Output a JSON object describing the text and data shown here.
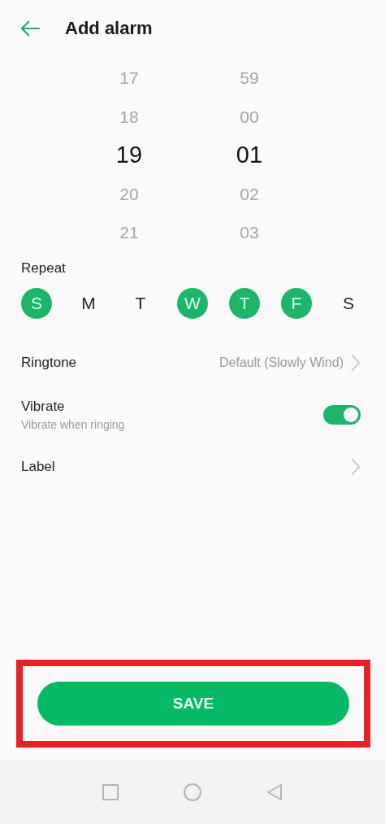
{
  "header": {
    "title": "Add alarm"
  },
  "time_picker": {
    "columns": [
      {
        "items": [
          {
            "text": "17",
            "selected": false
          },
          {
            "text": "18",
            "selected": false
          },
          {
            "text": "19",
            "selected": true
          },
          {
            "text": "20",
            "selected": false
          },
          {
            "text": "21",
            "selected": false
          }
        ]
      },
      {
        "items": [
          {
            "text": "59",
            "selected": false
          },
          {
            "text": "00",
            "selected": false
          },
          {
            "text": "01",
            "selected": true
          },
          {
            "text": "02",
            "selected": false
          },
          {
            "text": "03",
            "selected": false
          }
        ]
      }
    ]
  },
  "repeat": {
    "label": "Repeat",
    "days": [
      {
        "letter": "S",
        "selected": true
      },
      {
        "letter": "M",
        "selected": false
      },
      {
        "letter": "T",
        "selected": false
      },
      {
        "letter": "W",
        "selected": true
      },
      {
        "letter": "T",
        "selected": true
      },
      {
        "letter": "F",
        "selected": true
      },
      {
        "letter": "S",
        "selected": false
      }
    ]
  },
  "settings": [
    {
      "kind": "link",
      "title": "Ringtone",
      "value": "Default (Slowly Wind)"
    },
    {
      "kind": "toggle",
      "title": "Vibrate",
      "subtitle": "Vibrate when ringing",
      "on": true
    },
    {
      "kind": "link",
      "title": "Label"
    }
  ],
  "save_button": {
    "label": "SAVE",
    "highlighted": true
  },
  "nav_bar": {
    "buttons": [
      {
        "kind": "recents"
      },
      {
        "kind": "home"
      },
      {
        "kind": "back"
      }
    ]
  }
}
